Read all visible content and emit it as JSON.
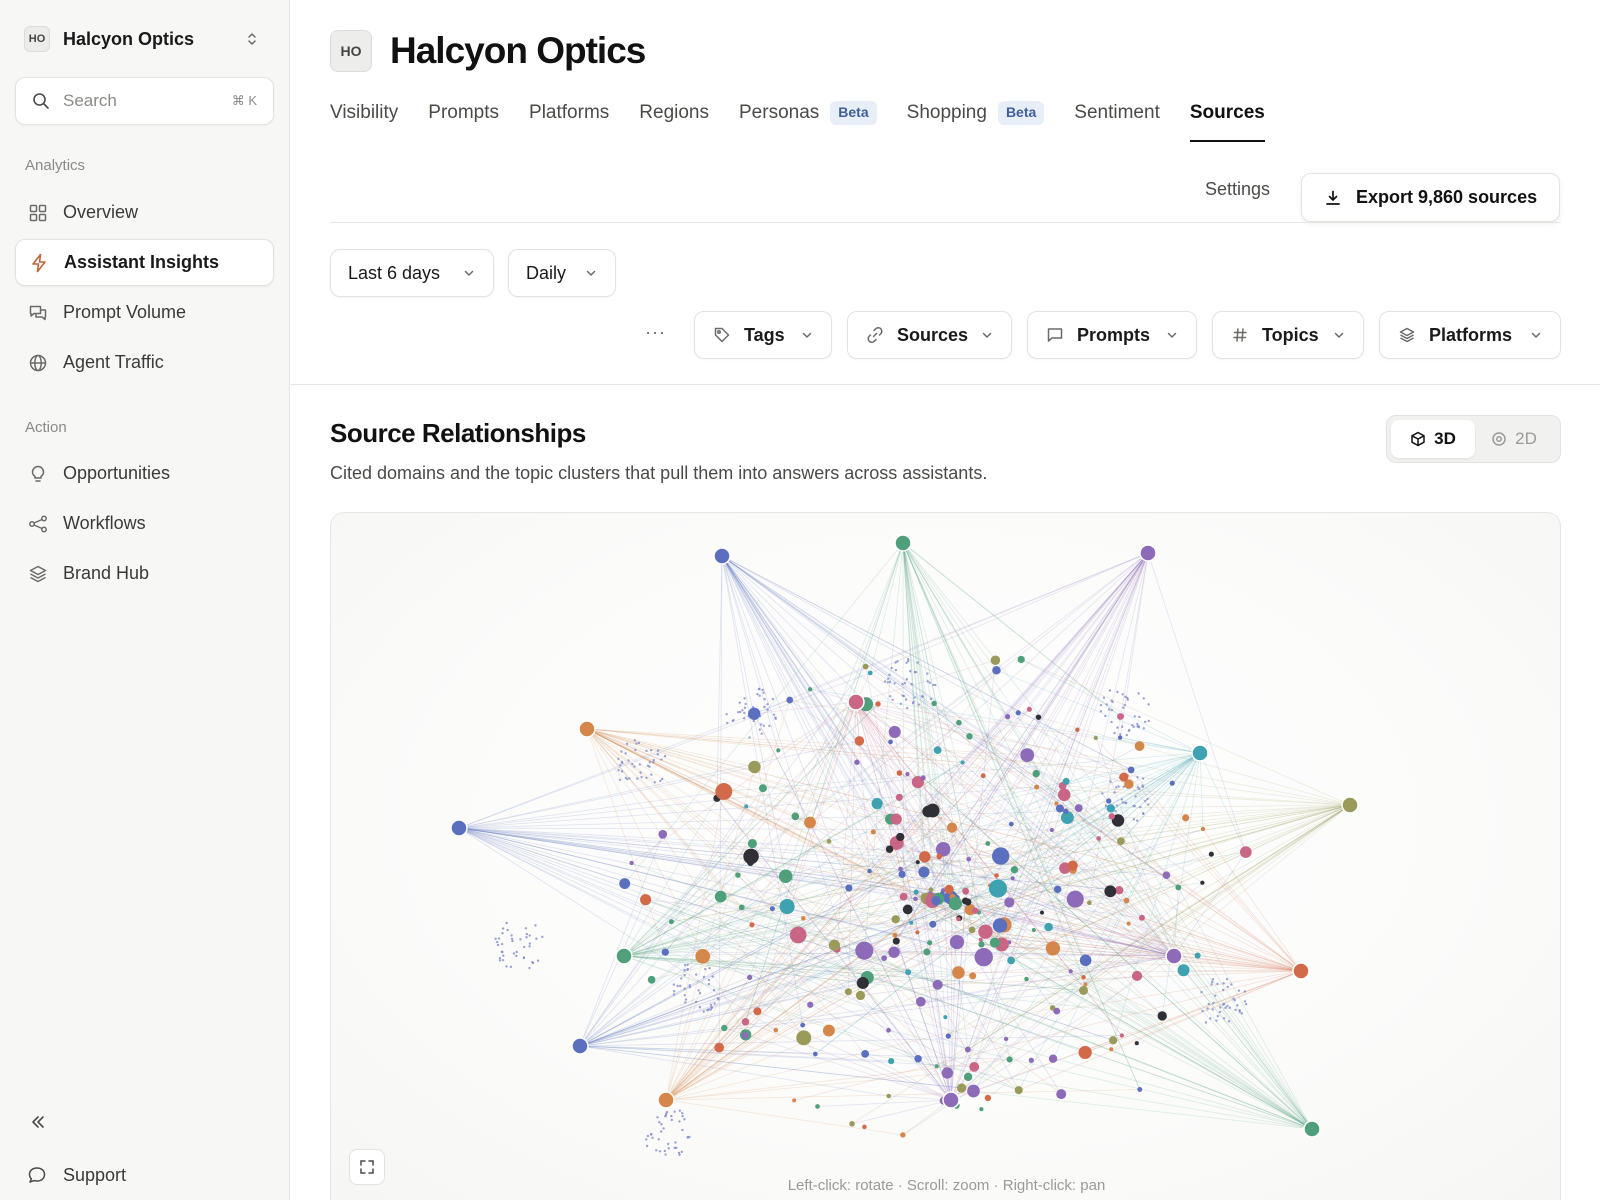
{
  "workspace": {
    "initials": "HO",
    "name": "Halcyon Optics"
  },
  "search": {
    "placeholder": "Search",
    "shortcut": "⌘ K"
  },
  "sidebar": {
    "sections": [
      {
        "label": "Analytics",
        "items": [
          {
            "label": "Overview",
            "icon": "grid-icon"
          },
          {
            "label": "Assistant Insights",
            "icon": "bolt-icon",
            "active": true
          },
          {
            "label": "Prompt Volume",
            "icon": "chat-icon"
          },
          {
            "label": "Agent Traffic",
            "icon": "globe-icon"
          }
        ]
      },
      {
        "label": "Action",
        "items": [
          {
            "label": "Opportunities",
            "icon": "lightbulb-icon"
          },
          {
            "label": "Workflows",
            "icon": "share-nodes-icon"
          },
          {
            "label": "Brand Hub",
            "icon": "layers-icon"
          }
        ]
      }
    ],
    "support_label": "Support"
  },
  "header": {
    "initials": "HO",
    "title": "Halcyon Optics",
    "tabs": [
      {
        "label": "Visibility"
      },
      {
        "label": "Prompts"
      },
      {
        "label": "Platforms"
      },
      {
        "label": "Regions"
      },
      {
        "label": "Personas",
        "badge": "Beta"
      },
      {
        "label": "Shopping",
        "badge": "Beta"
      },
      {
        "label": "Sentiment"
      },
      {
        "label": "Sources",
        "active": true
      }
    ],
    "settings_label": "Settings",
    "export_label": "Export 9,860 sources"
  },
  "filters": {
    "date_range": "Last 6 days",
    "granularity": "Daily",
    "more": "···",
    "dropdowns": [
      {
        "label": "Tags",
        "icon": "tag-icon"
      },
      {
        "label": "Sources",
        "icon": "link-icon"
      },
      {
        "label": "Prompts",
        "icon": "message-icon"
      },
      {
        "label": "Topics",
        "icon": "hash-icon"
      },
      {
        "label": "Platforms",
        "icon": "layers-icon"
      }
    ]
  },
  "section": {
    "title": "Source Relationships",
    "subtitle": "Cited domains and the topic clusters that pull them into answers across assistants.",
    "view_toggle": {
      "options": [
        "3D",
        "2D"
      ],
      "selected": "3D"
    },
    "hint": "Left-click: rotate · Scroll: zoom · Right-click: pan"
  },
  "colors": {
    "accent_bolt": "#c0643a",
    "node_palette": [
      "#5b6fbf",
      "#4fa07a",
      "#8d6bb8",
      "#d5864a",
      "#3fa2b0",
      "#9a9a5a",
      "#d26a4a",
      "#c96686",
      "#2f2f35"
    ]
  }
}
